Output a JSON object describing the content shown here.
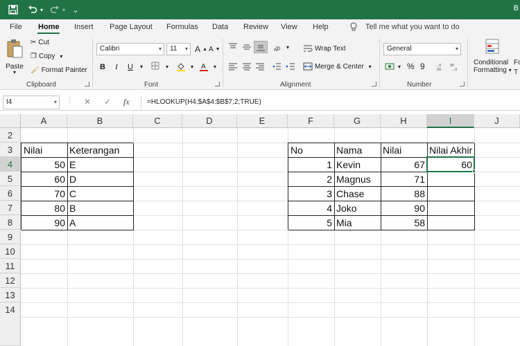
{
  "window": {
    "title_fragment": "B"
  },
  "quick_access": {
    "more": "⌄"
  },
  "tabs": [
    "File",
    "Home",
    "Insert",
    "Page Layout",
    "Formulas",
    "Data",
    "Review",
    "View",
    "Help"
  ],
  "tell_me": "Tell me what you want to do",
  "ribbon": {
    "clipboard": {
      "paste": "Paste",
      "cut": "Cut",
      "copy": "Copy",
      "format_painter": "Format Painter",
      "label": "Clipboard"
    },
    "font": {
      "name": "Calibri",
      "size": "11",
      "grow": "A",
      "shrink": "A",
      "bold": "B",
      "italic": "I",
      "underline": "U",
      "label": "Font"
    },
    "alignment": {
      "wrap_text": "Wrap Text",
      "merge_center": "Merge & Center",
      "label": "Alignment"
    },
    "number": {
      "format": "General",
      "percent": "%",
      "comma": "9",
      "label": "Number"
    },
    "styles": {
      "conditional": "Conditional",
      "formatting": "Formatting",
      "next_fragment_1": "Fo",
      "next_fragment_2": "T"
    }
  },
  "formula_bar": {
    "name_box": "I4",
    "cancel": "✕",
    "enter": "✓",
    "fx": "fx",
    "formula": "=HLOOKUP(H4;$A$4:$B$7;2;TRUE)"
  },
  "columns": [
    "A",
    "B",
    "C",
    "D",
    "E",
    "F",
    "G",
    "H",
    "I",
    "J"
  ],
  "rows": [
    "2",
    "3",
    "4",
    "5",
    "6",
    "7",
    "8",
    "9",
    "10",
    "11",
    "12",
    "13",
    "14"
  ],
  "active_cell": "I4",
  "left_table": {
    "headers": [
      "Nilai",
      "Keterangan"
    ],
    "rows": [
      [
        "50",
        "E"
      ],
      [
        "60",
        "D"
      ],
      [
        "70",
        "C"
      ],
      [
        "80",
        "B"
      ],
      [
        "90",
        "A"
      ]
    ]
  },
  "right_table": {
    "headers": [
      "No",
      "Nama",
      "Nilai",
      "Nilai Akhir"
    ],
    "rows": [
      [
        "1",
        "Kevin",
        "67",
        "60"
      ],
      [
        "2",
        "Magnus",
        "71",
        ""
      ],
      [
        "3",
        "Chase",
        "88",
        ""
      ],
      [
        "4",
        "Joko",
        "90",
        ""
      ],
      [
        "5",
        "Mia",
        "58",
        ""
      ]
    ]
  },
  "colors": {
    "excel_green": "#217346",
    "header_gray": "#efefef"
  }
}
